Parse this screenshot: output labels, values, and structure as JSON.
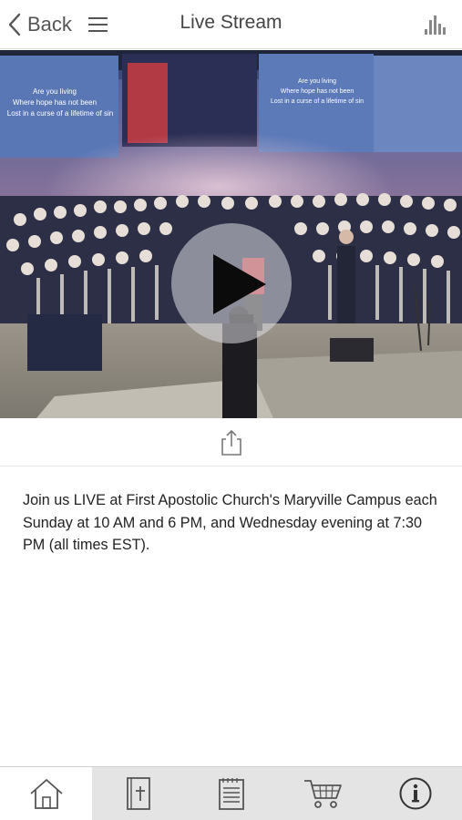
{
  "header": {
    "back_label": "Back",
    "title": "Live Stream"
  },
  "video": {
    "slide_left": [
      "Are you living",
      "Where hope has not been",
      "Lost in a curse of a lifetime of sin"
    ],
    "slide_right": [
      "Are you living",
      "Where hope has not been",
      "Lost in a curse of a lifetime of sin"
    ]
  },
  "description": "Join us LIVE at First Apostolic Church's Maryville Campus each Sunday at 10 AM and 6 PM, and Wednesday evening at 7:30 PM (all times EST).",
  "tabs": [
    {
      "icon": "home-icon",
      "active": true
    },
    {
      "icon": "bible-icon",
      "active": false
    },
    {
      "icon": "notes-icon",
      "active": false
    },
    {
      "icon": "cart-icon",
      "active": false
    },
    {
      "icon": "info-icon",
      "active": false
    }
  ],
  "colors": {
    "stage_wall": "#6d6a82",
    "choir_robe": "#2c2f45",
    "floor": "#8c877e",
    "tab_background": "#e4e4e4"
  }
}
